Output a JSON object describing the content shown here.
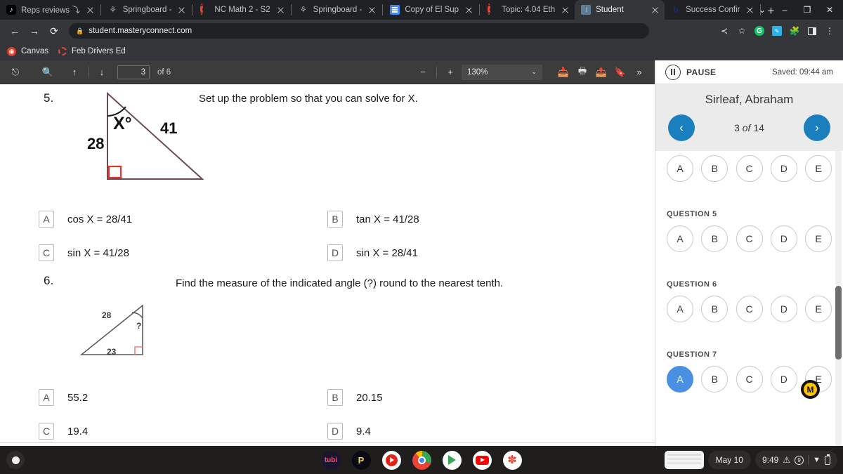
{
  "browser": {
    "tabs": [
      {
        "label": "Reps reviews ⤵",
        "icon": "tiktok-icon",
        "active": false
      },
      {
        "label": "Springboard - ",
        "icon": "shield-icon",
        "active": false
      },
      {
        "label": "NC Math 2 - S2",
        "icon": "ring-icon",
        "active": false
      },
      {
        "label": "Springboard - ",
        "icon": "shield-icon",
        "active": false
      },
      {
        "label": "Copy of El Sup",
        "icon": "google-docs-icon",
        "active": false
      },
      {
        "label": "Topic: 4.04 Eth",
        "icon": "ring-icon",
        "active": false
      },
      {
        "label": "Student",
        "icon": "student-icon",
        "active": true
      },
      {
        "label": "Success Confir",
        "icon": "brainly-icon",
        "active": false
      }
    ],
    "new_tab_label": "+",
    "window_controls": {
      "list": "⌄",
      "minimize": "–",
      "maximize": "❐",
      "close": "✕"
    },
    "url": "student.masteryconnect.com",
    "lock_icon": "lock-icon",
    "nav": {
      "back": "←",
      "forward": "→",
      "reload": "⟳"
    },
    "toolbar_icons": [
      "share-icon",
      "star-icon",
      "grammarly-extension-icon",
      "kami-extension-icon",
      "extensions-puzzle-icon",
      "side-panel-icon",
      "chrome-menu-icon"
    ],
    "bookmarks": [
      {
        "label": "Canvas",
        "icon": "canvas-icon"
      },
      {
        "label": "Feb Drivers Ed",
        "icon": "ring-icon"
      }
    ]
  },
  "pdf_toolbar": {
    "sidebar_toggle": "pdf-sidebar-icon",
    "search_icon": "search-icon",
    "prev_page_icon": "↑",
    "next_page_icon": "↓",
    "page_number": "3",
    "page_of": "of 6",
    "zoom_out": "−",
    "zoom_in": "+",
    "zoom_level": "130%",
    "zoom_chevron": "⌄",
    "right_icons": [
      "save-icon",
      "print-icon",
      "download-icon",
      "bookmark-icon",
      "more-tools-icon"
    ]
  },
  "document": {
    "questions": [
      {
        "number": "5.",
        "prompt": "Set up the problem so that you can solve for X.",
        "figure": {
          "type": "right-triangle",
          "angle_label": "X°",
          "side_vertical": "28",
          "side_hypotenuse": "41"
        },
        "options": [
          {
            "letter": "A",
            "text": "cos X = 28/41"
          },
          {
            "letter": "B",
            "text": "tan X = 41/28"
          },
          {
            "letter": "C",
            "text": "sin X = 41/28"
          },
          {
            "letter": "D",
            "text": "sin X = 28/41"
          }
        ]
      },
      {
        "number": "6.",
        "prompt": "Find the measure of the indicated angle (?) round to the nearest tenth.",
        "figure": {
          "type": "right-triangle",
          "angle_label": "?",
          "side_hypotenuse": "28",
          "side_base": "23"
        },
        "options": [
          {
            "letter": "A",
            "text": "55.2"
          },
          {
            "letter": "B",
            "text": "20.15"
          },
          {
            "letter": "C",
            "text": "19.4"
          },
          {
            "letter": "D",
            "text": "9.4"
          }
        ]
      }
    ]
  },
  "sidebar": {
    "pause_label": "PAUSE",
    "pause_icon": "pause-icon",
    "saved_text": "Saved: 09:44 am",
    "student_name": "Sirleaf, Abraham",
    "prev_icon": "‹",
    "next_icon": "›",
    "progress_prefix": "3",
    "progress_italic": "of",
    "progress_suffix": "14",
    "questions": [
      {
        "label": "",
        "choices": [
          "A",
          "B",
          "C",
          "D",
          "E"
        ],
        "selected": null
      },
      {
        "label": "QUESTION 5",
        "choices": [
          "A",
          "B",
          "C",
          "D",
          "E"
        ],
        "selected": null
      },
      {
        "label": "QUESTION 6",
        "choices": [
          "A",
          "B",
          "C",
          "D",
          "E"
        ],
        "selected": null
      },
      {
        "label": "QUESTION 7",
        "choices": [
          "A",
          "B",
          "C",
          "D",
          "E"
        ],
        "selected": "A"
      }
    ],
    "badge_letter": "M"
  },
  "shelf": {
    "launcher_icon": "launcher-icon",
    "apps": [
      {
        "name": "tubi-app-icon",
        "label": "tubi"
      },
      {
        "name": "pluto-tv-app-icon",
        "label": "P"
      },
      {
        "name": "youtube-music-app-icon",
        "label": ""
      },
      {
        "name": "chrome-app-icon",
        "label": ""
      },
      {
        "name": "google-play-app-icon",
        "label": ""
      },
      {
        "name": "youtube-app-icon",
        "label": ""
      },
      {
        "name": "google-photos-app-icon",
        "label": "✽"
      }
    ],
    "window_preview": "window-preview",
    "date": "May 10",
    "time": "9:49",
    "warning_icon": "⚠",
    "notification_count": "9",
    "wifi_icon": "▼",
    "battery_icon": "battery-icon"
  },
  "colors": {
    "accent_blue": "#1b7fbd",
    "selected_blue": "#4a90e2",
    "chrome_dark": "#202124",
    "toolbar_dark": "#35363a",
    "pdf_bar": "#3c3c3c",
    "badge_yellow": "#ffc400"
  }
}
